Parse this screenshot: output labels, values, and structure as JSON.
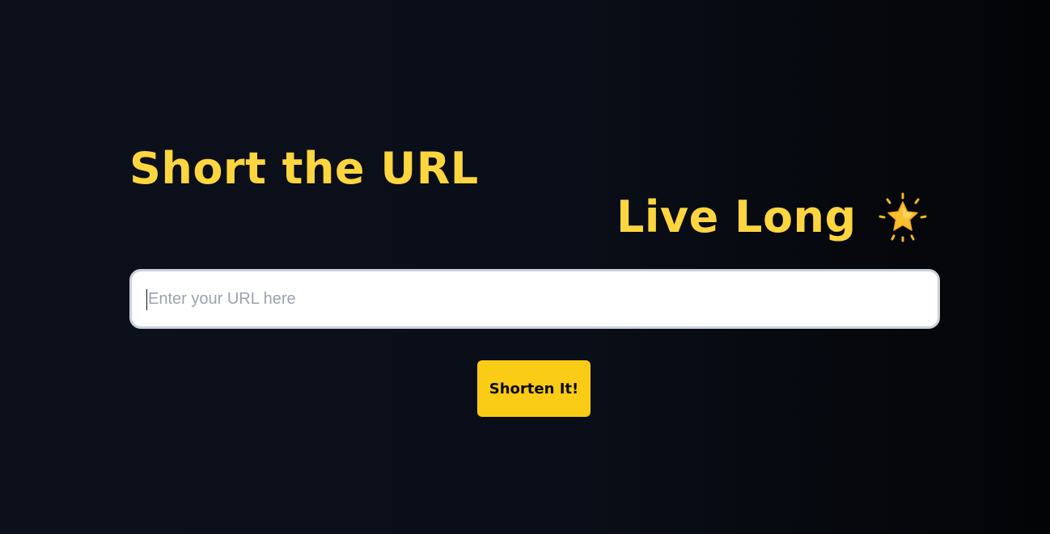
{
  "hero": {
    "headline_line1": "Short the URL",
    "headline_line2": "Live Long",
    "headline_icon": "glowing-star-icon"
  },
  "form": {
    "url_placeholder": "Enter your URL here",
    "url_value": "",
    "submit_label": "Shorten It!"
  },
  "colors": {
    "accent": "#fcd53f",
    "button": "#facc15",
    "background": "#0b101b"
  }
}
